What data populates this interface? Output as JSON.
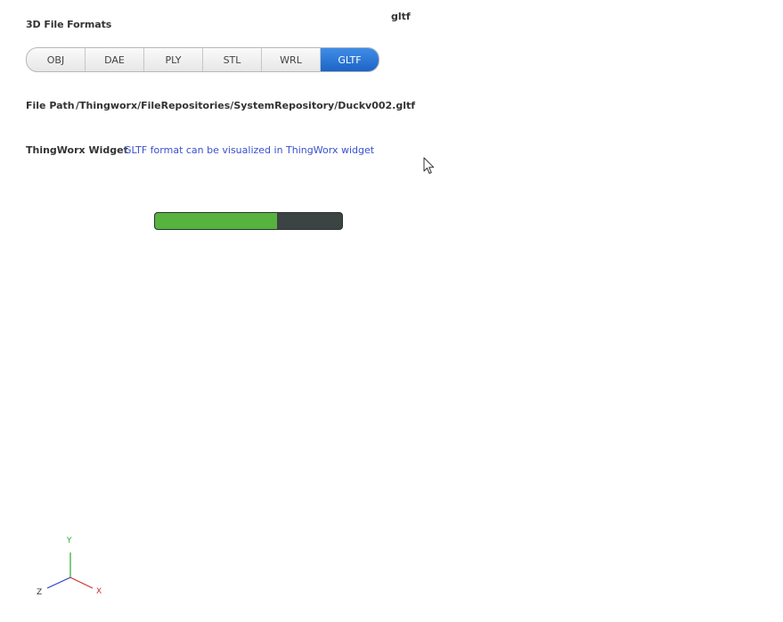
{
  "header": {
    "section_title": "3D File Formats",
    "selected_format": "gltf"
  },
  "formats": {
    "items": [
      "OBJ",
      "DAE",
      "PLY",
      "STL",
      "WRL",
      "GLTF"
    ],
    "active": "GLTF",
    "active_color": "#1d64c6"
  },
  "file_path": {
    "label": "File Path",
    "value": "/Thingworx/FileRepositories/SystemRepository/Duckv002.gltf"
  },
  "widget": {
    "label": "ThingWorx Widget",
    "link_text": "GLTF format can be visualized in ThingWorx widget",
    "link_color": "#3a4fd0"
  },
  "progress": {
    "fraction": 0.65,
    "fill_color": "#56b33f",
    "track_color": "#3b4343"
  },
  "axes_gizmo": {
    "x_label": "X",
    "y_label": "Y",
    "z_label": "Z",
    "x_color": "#d03030",
    "y_color": "#2aa82a",
    "z_color": "#2b3fbf"
  },
  "cursor": {
    "icon": "mouse-pointer-icon"
  }
}
